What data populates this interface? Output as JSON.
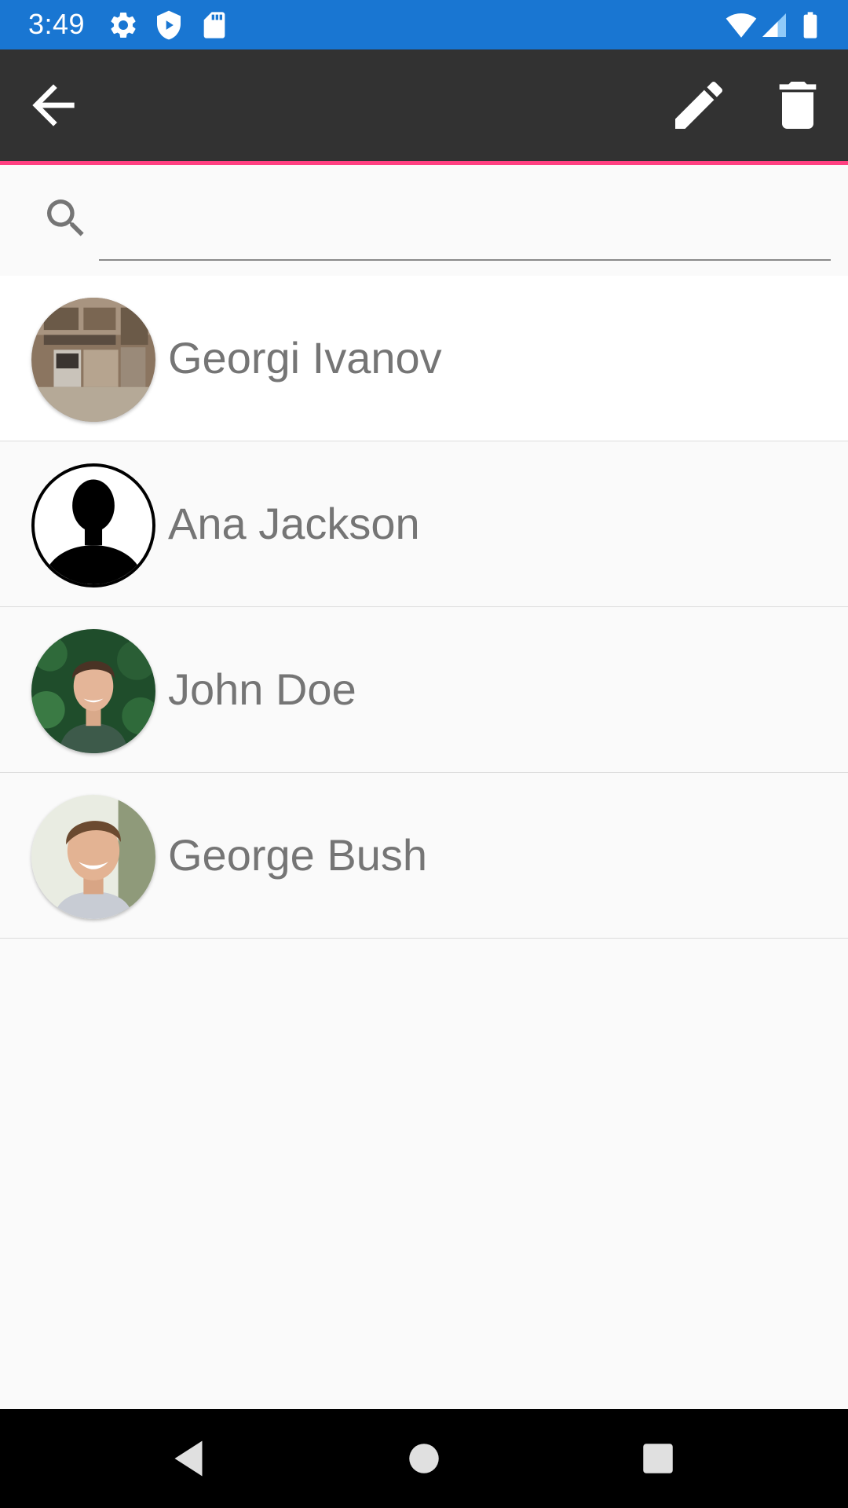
{
  "status_bar": {
    "time": "3:49",
    "background_color": "#1976d2",
    "left_icons": [
      "settings-icon",
      "shield-icon",
      "sd-card-icon"
    ],
    "right_icons": [
      "wifi-icon",
      "cell-signal-icon",
      "battery-icon"
    ]
  },
  "toolbar": {
    "background_color": "#323232",
    "accent_color": "#ff4081",
    "back_icon": "arrow-back-icon",
    "edit_icon": "pencil-icon",
    "delete_icon": "trash-icon"
  },
  "search": {
    "value": "",
    "placeholder": "",
    "icon": "search-icon"
  },
  "contacts": [
    {
      "name": "Georgi Ivanov",
      "avatar": "kitchen-photo-avatar",
      "selected": true
    },
    {
      "name": "Ana Jackson",
      "avatar": "silhouette-avatar",
      "selected": false
    },
    {
      "name": "John Doe",
      "avatar": "man-leaves-photo-avatar",
      "selected": false
    },
    {
      "name": "George Bush",
      "avatar": "smiling-man-photo-avatar",
      "selected": false
    }
  ],
  "nav_bar": {
    "back_icon": "nav-back-icon",
    "home_icon": "nav-home-icon",
    "recents_icon": "nav-recents-icon"
  }
}
